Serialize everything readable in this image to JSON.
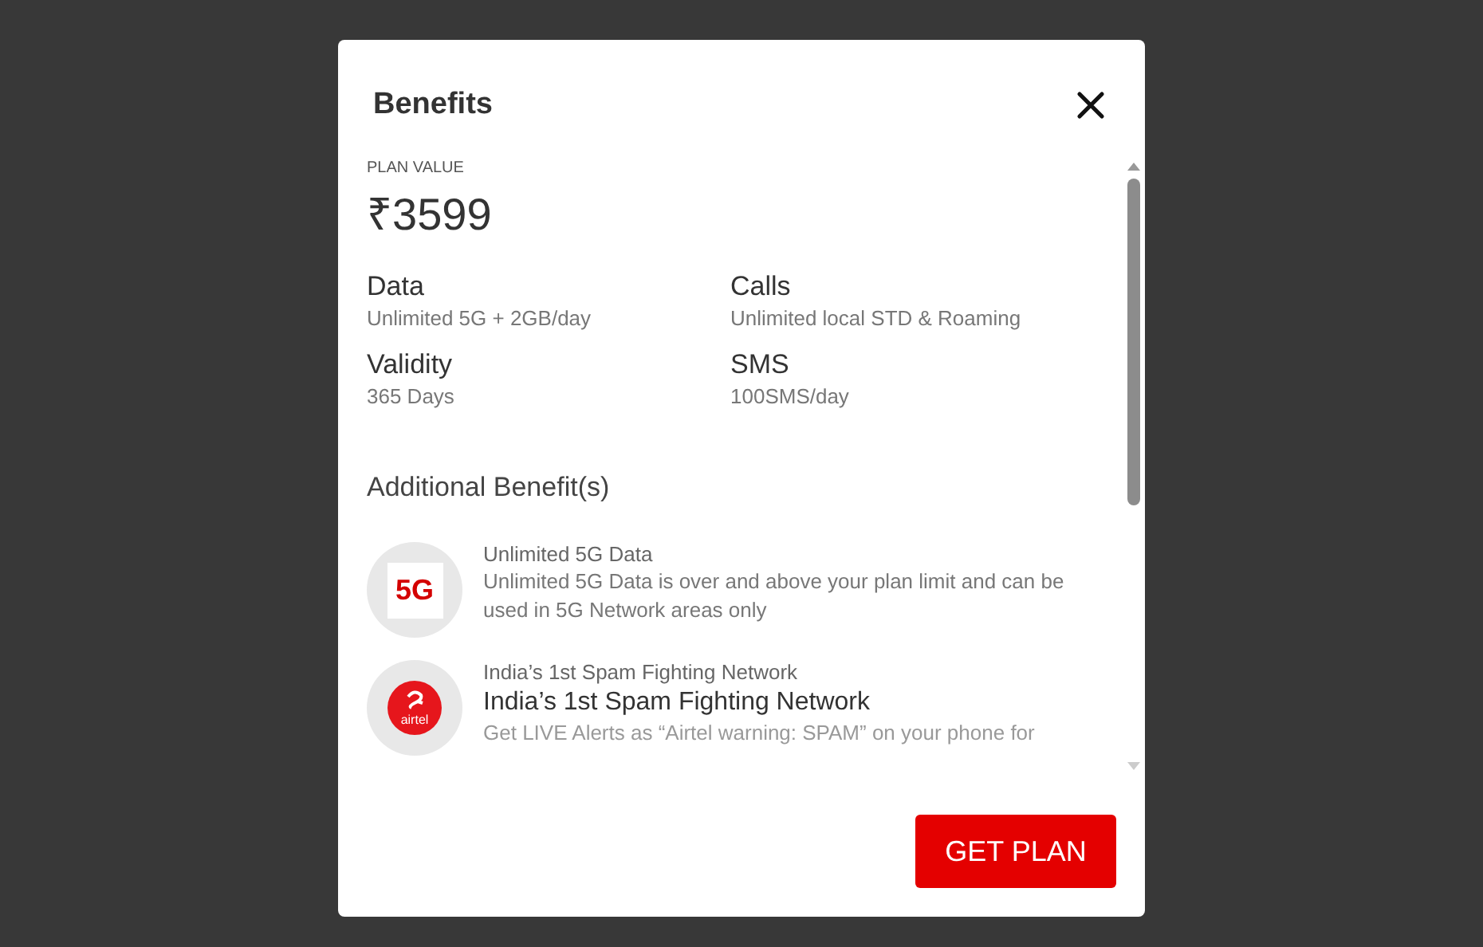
{
  "dialog": {
    "title": "Benefits"
  },
  "plan_value": {
    "label": "PLAN VALUE",
    "amount": "₹3599"
  },
  "benefits": [
    {
      "name": "Data",
      "value": "Unlimited 5G + 2GB/day"
    },
    {
      "name": "Calls",
      "value": "Unlimited local STD & Roaming"
    },
    {
      "name": "Validity",
      "value": "365 Days"
    },
    {
      "name": "SMS",
      "value": "100SMS/day"
    }
  ],
  "additional": {
    "heading": "Additional Benefit(s)",
    "items": [
      {
        "kind": "five-g",
        "logo_text": "5G",
        "title": "Unlimited 5G Data",
        "description": "Unlimited 5G Data is over and above your plan limit and can be used in 5G Network areas only"
      },
      {
        "kind": "airtel",
        "logo_text": "airtel",
        "title": "India’s 1st Spam Fighting Network",
        "subtitle": "India’s 1st Spam Fighting Network",
        "description": "Get LIVE Alerts as “Airtel warning: SPAM” on your phone for"
      }
    ]
  },
  "button": "GET PLAN"
}
